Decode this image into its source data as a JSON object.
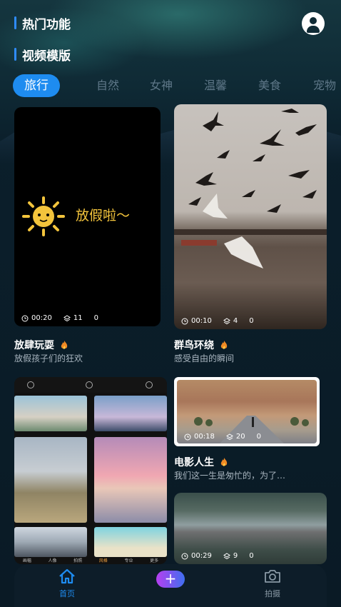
{
  "header": {
    "hot_features": "热门功能",
    "video_templates": "视频模版"
  },
  "tabs": [
    {
      "label": "旅行",
      "active": true
    },
    {
      "label": "自然",
      "active": false
    },
    {
      "label": "女神",
      "active": false
    },
    {
      "label": "温馨",
      "active": false
    },
    {
      "label": "美食",
      "active": false
    },
    {
      "label": "宠物",
      "active": false
    }
  ],
  "cards": [
    {
      "overlay_text": "放假啦～",
      "duration": "00:20",
      "layers": "11",
      "count": "0",
      "title": "放肆玩耍",
      "subtitle": "放假孩子们的狂欢"
    },
    {
      "duration": "00:10",
      "layers": "4",
      "count": "0",
      "title": "群鸟环绕",
      "subtitle": "感受自由的瞬间"
    },
    {
      "phone_labels": [
        "画幅",
        "人像",
        "拍照",
        "风格",
        "专业",
        "更多"
      ]
    },
    {
      "duration": "00:18",
      "layers": "20",
      "count": "0",
      "title": "电影人生",
      "subtitle": "我们这一生是匆忙的，为了…"
    },
    {
      "duration": "00:29",
      "layers": "9",
      "count": "0"
    }
  ],
  "nav": {
    "home": "首页",
    "shoot": "拍摄",
    "plus": "+"
  },
  "colors": {
    "accent": "#1e8cf0",
    "background": "#0c1b26"
  }
}
